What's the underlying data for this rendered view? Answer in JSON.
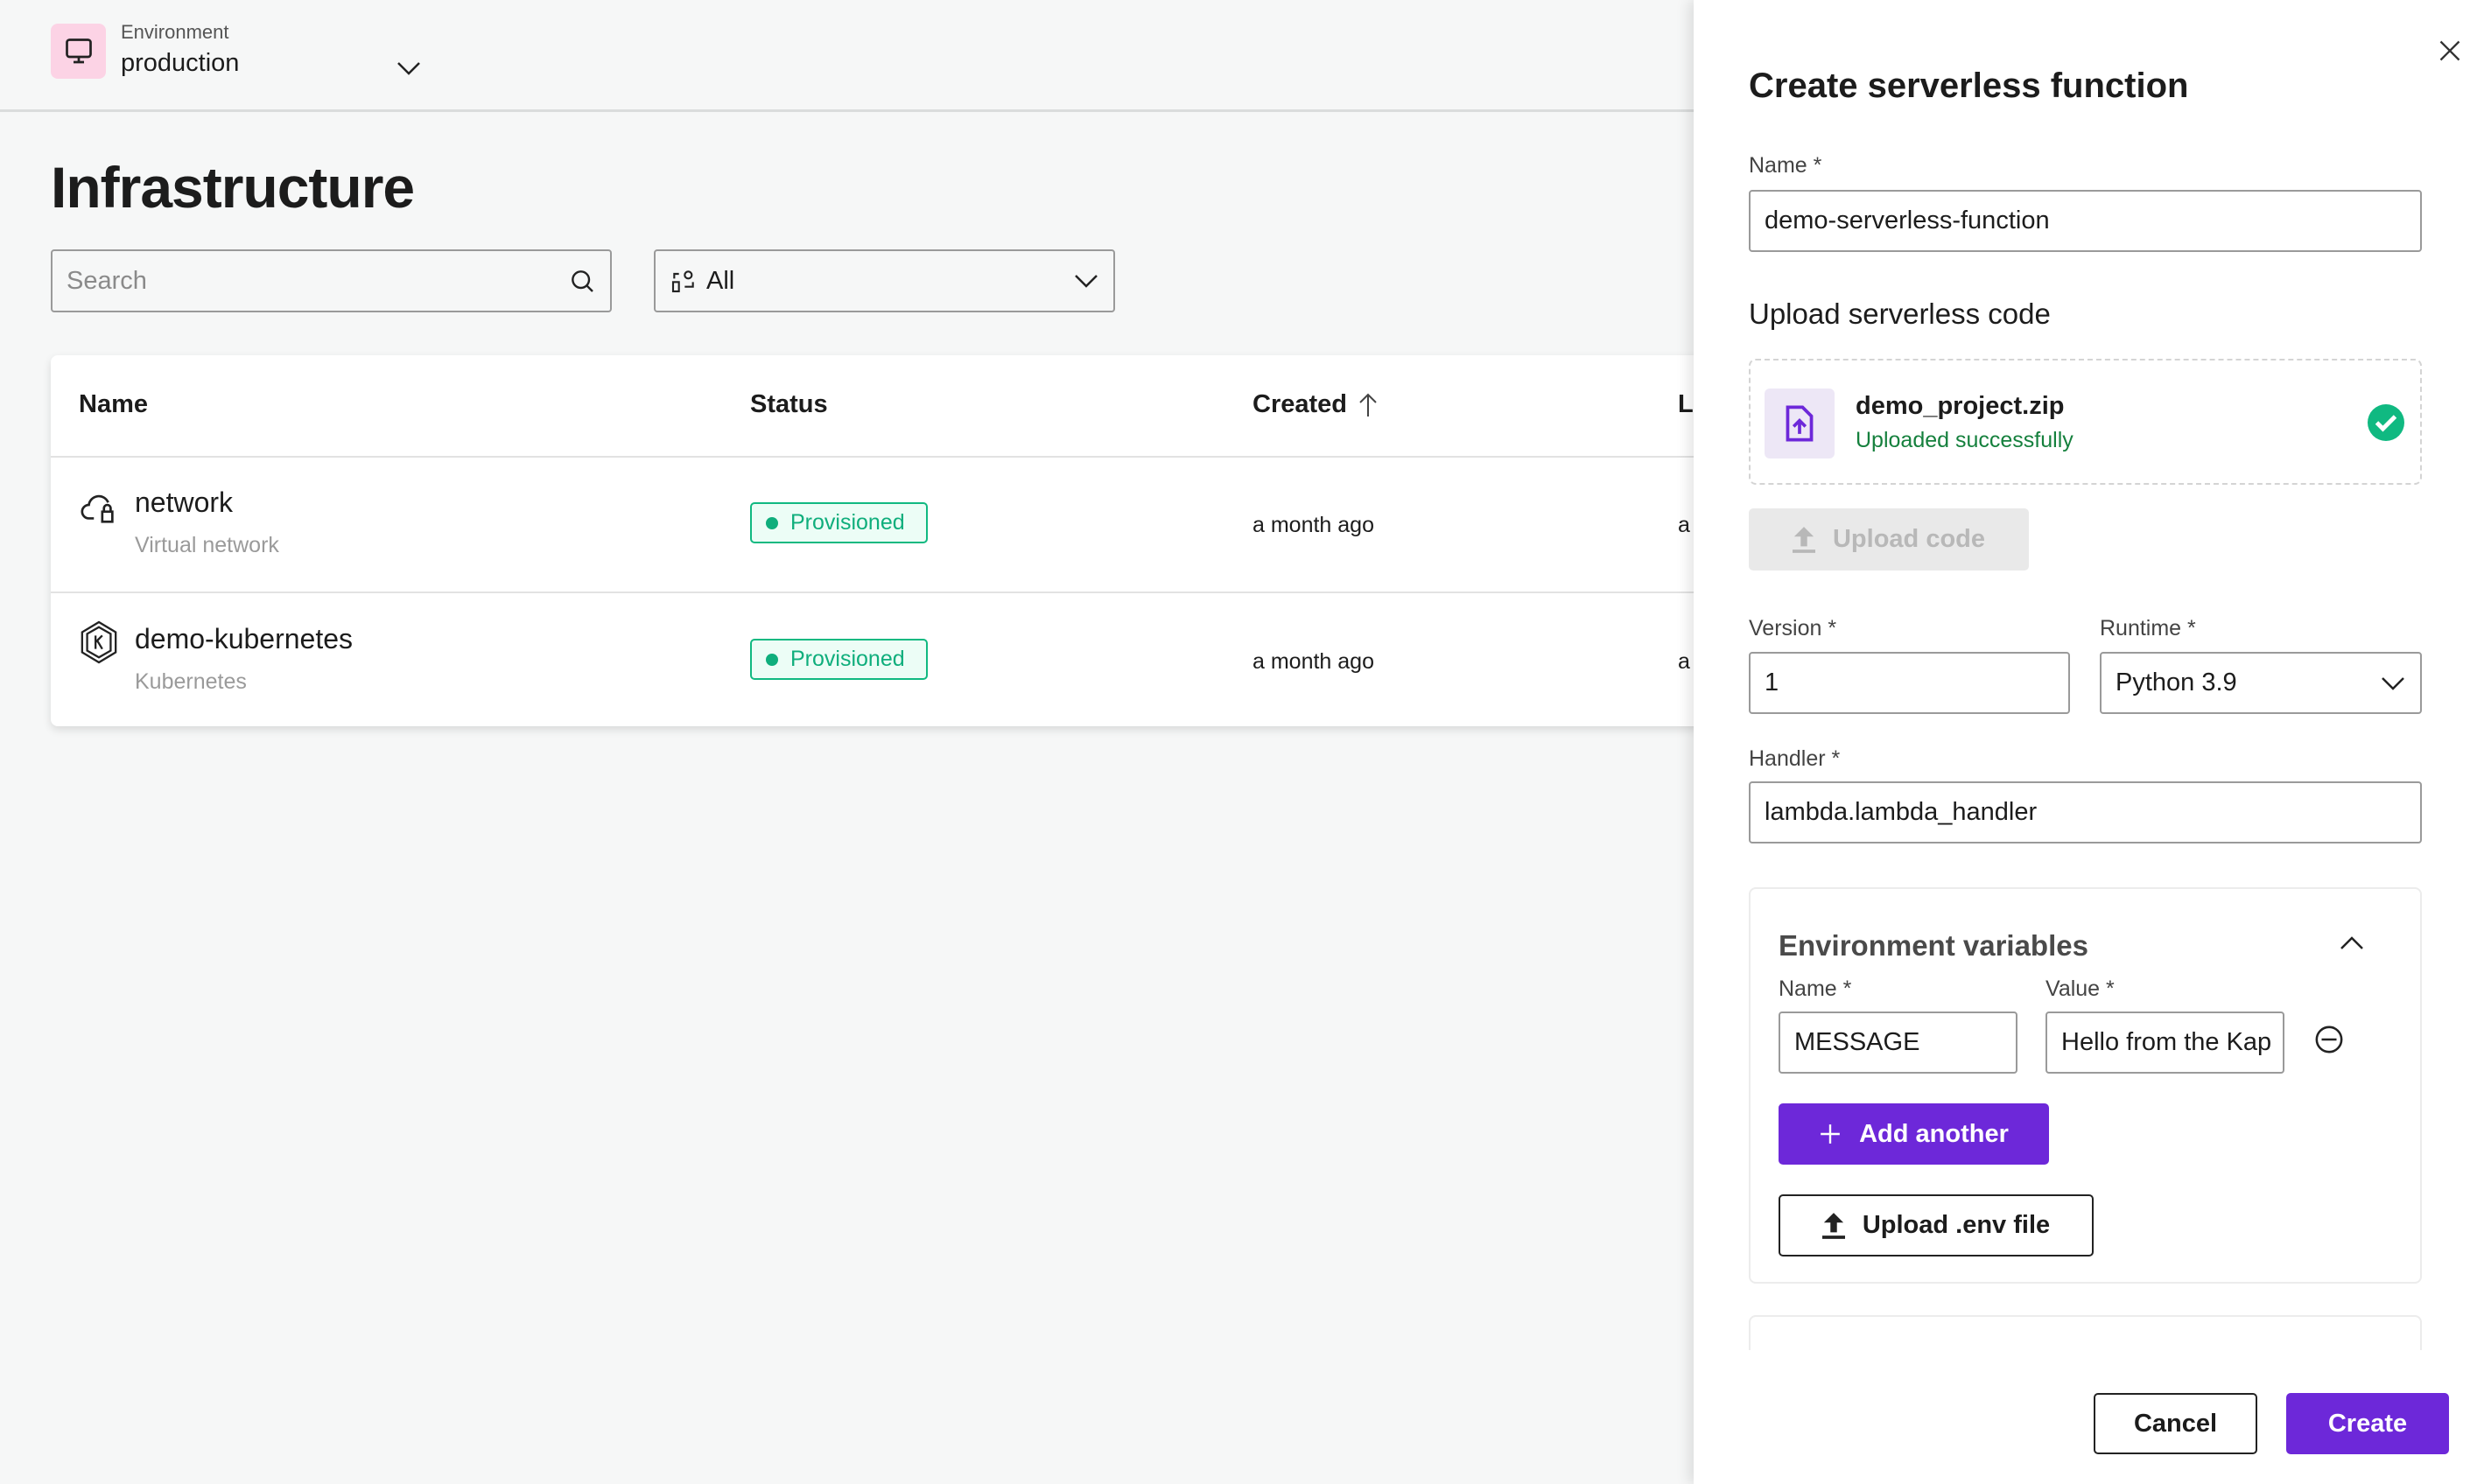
{
  "header": {
    "env_label": "Environment",
    "env_value": "production",
    "icon": "monitor-icon"
  },
  "page": {
    "title": "Infrastructure"
  },
  "toolbar": {
    "search_placeholder": "Search",
    "filter_value": "All"
  },
  "table": {
    "columns": [
      "Name",
      "Status",
      "Created",
      "L"
    ],
    "rows": [
      {
        "name": "network",
        "type": "Virtual network",
        "icon": "cloud-lock-icon",
        "status": "Provisioned",
        "created": "a month ago",
        "last": "a"
      },
      {
        "name": "demo-kubernetes",
        "type": "Kubernetes",
        "icon": "kubernetes-icon",
        "status": "Provisioned",
        "created": "a month ago",
        "last": "a"
      }
    ]
  },
  "panel": {
    "title": "Create serverless function",
    "name_label": "Name *",
    "name_value": "demo-serverless-function",
    "upload_heading": "Upload serverless code",
    "file_name": "demo_project.zip",
    "file_status": "Uploaded successfully",
    "upload_button": "Upload code",
    "version_label": "Version *",
    "version_value": "1",
    "runtime_label": "Runtime *",
    "runtime_value": "Python 3.9",
    "handler_label": "Handler *",
    "handler_value": "lambda.lambda_handler",
    "env": {
      "title": "Environment variables",
      "name_label": "Name *",
      "value_label": "Value *",
      "name_value": "MESSAGE",
      "value_value": "Hello from the Kap",
      "add_button": "Add another",
      "upload_env_button": "Upload .env file"
    },
    "cancel": "Cancel",
    "create": "Create"
  },
  "colors": {
    "accent": "#6d28d9",
    "success": "#10b981",
    "success_text": "#15803d"
  }
}
